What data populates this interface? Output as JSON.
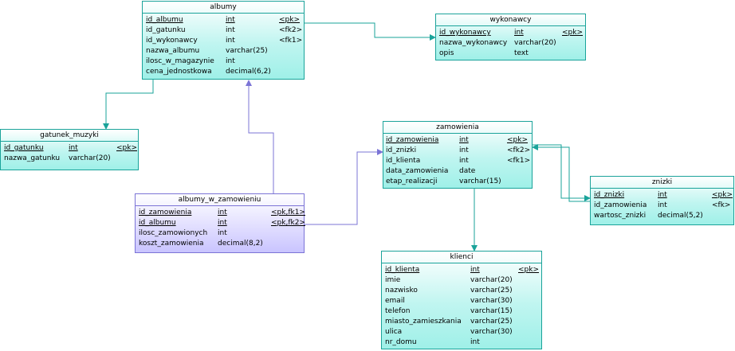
{
  "entities": {
    "albumy": {
      "title": "albumy",
      "rows": [
        {
          "name": "id_albumu",
          "type": "int",
          "key": "<pk>",
          "pk": true
        },
        {
          "name": "id_gatunku",
          "type": "int",
          "key": "<fk2>",
          "pk": false
        },
        {
          "name": "id_wykonawcy",
          "type": "int",
          "key": "<fk1>",
          "pk": false
        },
        {
          "name": "nazwa_albumu",
          "type": "varchar(25)",
          "key": "",
          "pk": false
        },
        {
          "name": "ilosc_w_magazynie",
          "type": "int",
          "key": "",
          "pk": false
        },
        {
          "name": "cena_jednostkowa",
          "type": "decimal(6,2)",
          "key": "",
          "pk": false
        }
      ]
    },
    "wykonawcy": {
      "title": "wykonawcy",
      "rows": [
        {
          "name": "id_wykonawcy",
          "type": "int",
          "key": "<pk>",
          "pk": true
        },
        {
          "name": "nazwa_wykonawcy",
          "type": "varchar(20)",
          "key": "",
          "pk": false
        },
        {
          "name": "opis",
          "type": "text",
          "key": "",
          "pk": false
        }
      ]
    },
    "gatunek_muzyki": {
      "title": "gatunek_muzyki",
      "rows": [
        {
          "name": "id_gatunku",
          "type": "int",
          "key": "<pk>",
          "pk": true
        },
        {
          "name": "nazwa_gatunku",
          "type": "varchar(20)",
          "key": "",
          "pk": false
        }
      ]
    },
    "zamowienia": {
      "title": "zamowienia",
      "rows": [
        {
          "name": "id_zamowienia",
          "type": "int",
          "key": "<pk>",
          "pk": true
        },
        {
          "name": "id_znizki",
          "type": "int",
          "key": "<fk2>",
          "pk": false
        },
        {
          "name": "id_klienta",
          "type": "int",
          "key": "<fk1>",
          "pk": false
        },
        {
          "name": "data_zamowienia",
          "type": "date",
          "key": "",
          "pk": false
        },
        {
          "name": "etap_realizacji",
          "type": "varchar(15)",
          "key": "",
          "pk": false
        }
      ]
    },
    "albumy_w_zamowieniu": {
      "title": "albumy_w_zamowieniu",
      "rows": [
        {
          "name": "id_zamowienia",
          "type": "int",
          "key": "<pk,fk1>",
          "pk": true
        },
        {
          "name": "id_albumu",
          "type": "int",
          "key": "<pk,fk2>",
          "pk": true
        },
        {
          "name": "ilosc_zamowionych",
          "type": "int",
          "key": "",
          "pk": false
        },
        {
          "name": "koszt_zamowienia",
          "type": "decimal(8,2)",
          "key": "",
          "pk": false
        }
      ]
    },
    "znizki": {
      "title": "znizki",
      "rows": [
        {
          "name": "id_znizki",
          "type": "int",
          "key": "<pk>",
          "pk": true
        },
        {
          "name": "id_zamowienia",
          "type": "int",
          "key": "<fk>",
          "pk": false
        },
        {
          "name": "wartosc_znizki",
          "type": "decimal(5,2)",
          "key": "",
          "pk": false
        }
      ]
    },
    "klienci": {
      "title": "klienci",
      "rows": [
        {
          "name": "id_klienta",
          "type": "int",
          "key": "<pk>",
          "pk": true
        },
        {
          "name": "imie",
          "type": "varchar(20)",
          "key": "",
          "pk": false
        },
        {
          "name": "nazwisko",
          "type": "varchar(25)",
          "key": "",
          "pk": false
        },
        {
          "name": "email",
          "type": "varchar(30)",
          "key": "",
          "pk": false
        },
        {
          "name": "telefon",
          "type": "varchar(15)",
          "key": "",
          "pk": false
        },
        {
          "name": "miasto_zamieszkania",
          "type": "varchar(25)",
          "key": "",
          "pk": false
        },
        {
          "name": "ulica",
          "type": "varchar(30)",
          "key": "",
          "pk": false
        },
        {
          "name": "nr_domu",
          "type": "int",
          "key": "",
          "pk": false
        }
      ]
    }
  },
  "colors": {
    "teal": "#1aa39a",
    "purple": "#7b74d6"
  }
}
